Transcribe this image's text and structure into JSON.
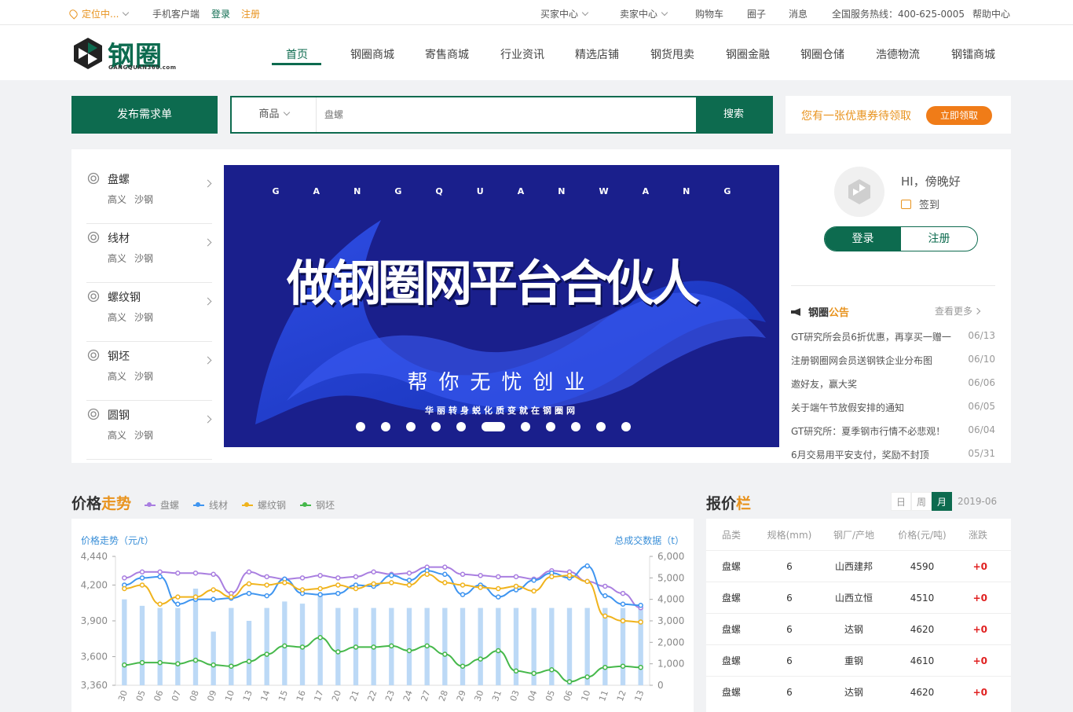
{
  "topbar": {
    "location": "定位中...",
    "mobile": "手机客户端",
    "login": "登录",
    "register": "注册",
    "buyer_center": "买家中心",
    "seller_center": "卖家中心",
    "cart": "购物车",
    "circle": "圈子",
    "messages": "消息",
    "hotline": "全国服务热线：400-625-0005",
    "help": "帮助中心"
  },
  "logo": {
    "text": "钢圈",
    "sub": "GANGQUAN360.com"
  },
  "nav": [
    "首页",
    "钢圈商城",
    "寄售商城",
    "行业资讯",
    "精选店铺",
    "钢货甩卖",
    "钢圈金融",
    "钢圈仓储",
    "浩德物流",
    "钢镭商城"
  ],
  "search": {
    "publish_label": "发布需求单",
    "category": "商品",
    "placeholder": "盘螺",
    "button": "搜索"
  },
  "coupon": {
    "text": "您有一张优惠券待领取",
    "button": "立即领取"
  },
  "categories": [
    {
      "name": "盘螺",
      "subs": [
        "高义",
        "沙钢"
      ]
    },
    {
      "name": "线材",
      "subs": [
        "高义",
        "沙钢"
      ]
    },
    {
      "name": "螺纹钢",
      "subs": [
        "高义",
        "沙钢"
      ]
    },
    {
      "name": "钢坯",
      "subs": [
        "高义",
        "沙钢"
      ]
    },
    {
      "name": "圆钢",
      "subs": [
        "高义",
        "沙钢"
      ]
    }
  ],
  "banner": {
    "letters": [
      "G",
      "A",
      "N",
      "G",
      "Q",
      "U",
      "A",
      "N",
      "W",
      "A",
      "N",
      "G"
    ],
    "title": "做钢圈网平台合伙人",
    "slogan": "帮你无忧创业",
    "subline": "华丽转身蜕化质变就在钢圈网",
    "dot_count": 11,
    "active_dot": 5
  },
  "user": {
    "greeting": "HI，傍晚好",
    "checkin": "签到",
    "login": "登录",
    "register": "注册"
  },
  "notices": {
    "title_a": "钢圈",
    "title_b": "公告",
    "more": "查看更多",
    "items": [
      {
        "text": "GT研究所会员6折优惠，再享买一赠一",
        "date": "06/13"
      },
      {
        "text": "注册钢圈网会员送钢铁企业分布图",
        "date": "06/10"
      },
      {
        "text": "邀好友，赢大奖",
        "date": "06/06"
      },
      {
        "text": "关于端午节放假安排的通知",
        "date": "06/05"
      },
      {
        "text": "GT研究所：夏季钢市行情不必悲观！",
        "date": "06/04"
      },
      {
        "text": "6月交易用平安支付，奖励不封顶",
        "date": "05/31"
      }
    ]
  },
  "price_section": {
    "title_a": "价格",
    "title_b": "走势",
    "legend": [
      {
        "name": "盘螺",
        "color": "#a97ee0"
      },
      {
        "name": "线材",
        "color": "#3f95f0"
      },
      {
        "name": "螺纹钢",
        "color": "#f0b31c"
      },
      {
        "name": "钢坯",
        "color": "#45b84a"
      }
    ]
  },
  "chart_data": {
    "type": "line",
    "left_label": "价格走势（元/t）",
    "right_label": "总成交数据（t）",
    "x": [
      "30",
      "05",
      "06",
      "07",
      "08",
      "09",
      "10",
      "13",
      "14",
      "15",
      "16",
      "17",
      "20",
      "21",
      "22",
      "23",
      "24",
      "27",
      "28",
      "29",
      "30",
      "31",
      "03",
      "04",
      "05",
      "06",
      "10",
      "11",
      "12",
      "13"
    ],
    "y_left_ticks": [
      3360,
      3600,
      3900,
      4200,
      4440
    ],
    "y_right_ticks": [
      0,
      1000,
      2000,
      3000,
      4000,
      5000,
      6000
    ],
    "ylim_left": [
      3360,
      4440
    ],
    "ylim_right": [
      0,
      6000
    ],
    "series": [
      {
        "name": "盘螺",
        "color": "#a97ee0",
        "values": [
          4260,
          4310,
          4310,
          4300,
          4300,
          4290,
          4130,
          4310,
          4270,
          4250,
          4260,
          4280,
          4260,
          4270,
          4310,
          4290,
          4300,
          4350,
          4350,
          4290,
          4280,
          4270,
          4270,
          4250,
          4320,
          4310,
          4230,
          4190,
          4130,
          4010
        ]
      },
      {
        "name": "线材",
        "color": "#3f95f0",
        "values": [
          4200,
          4260,
          4270,
          4040,
          4080,
          4080,
          4090,
          4130,
          4110,
          4250,
          4130,
          4120,
          4130,
          4200,
          4190,
          4280,
          4240,
          4320,
          4290,
          4120,
          4200,
          4100,
          4160,
          4240,
          4300,
          4260,
          4360,
          4110,
          4040,
          4030
        ]
      },
      {
        "name": "螺纹钢",
        "color": "#f0b31c",
        "values": [
          4170,
          4200,
          4040,
          4100,
          4100,
          4160,
          4100,
          4210,
          4200,
          4220,
          4160,
          4170,
          4200,
          4170,
          4210,
          4220,
          4200,
          4290,
          4220,
          4200,
          4180,
          4170,
          4190,
          4150,
          4270,
          4280,
          4230,
          3940,
          3900,
          3890
        ]
      },
      {
        "name": "钢坯",
        "color": "#45b84a",
        "values": [
          3530,
          3550,
          3550,
          3540,
          3570,
          3530,
          3520,
          3560,
          3620,
          3690,
          3680,
          3760,
          3640,
          3680,
          3680,
          3690,
          3650,
          3690,
          3620,
          3520,
          3580,
          3650,
          3480,
          3460,
          3490,
          3390,
          3430,
          3510,
          3520,
          3510
        ]
      },
      {
        "name": "总成交数据",
        "type": "bar",
        "axis": "right",
        "values": [
          4000,
          3700,
          3600,
          3600,
          4500,
          2500,
          3600,
          3000,
          3600,
          3900,
          3800,
          4200,
          3600,
          3600,
          3600,
          3600,
          3600,
          3600,
          3600,
          3600,
          3600,
          3600,
          3600,
          3600,
          3600,
          3600,
          3600,
          3600,
          3600,
          3600
        ]
      }
    ]
  },
  "quotes": {
    "title_a": "报价",
    "title_b": "栏",
    "range_tabs": [
      "日",
      "周",
      "月"
    ],
    "active_range": 2,
    "date": "2019-06",
    "headers": [
      "品类",
      "规格(mm)",
      "钢厂/产地",
      "价格(元/吨)",
      "涨跌"
    ],
    "rows": [
      [
        "盘螺",
        "6",
        "山西建邦",
        "4590",
        "+0"
      ],
      [
        "盘螺",
        "6",
        "山西立恒",
        "4510",
        "+0"
      ],
      [
        "盘螺",
        "6",
        "达钢",
        "4620",
        "+0"
      ],
      [
        "盘螺",
        "6",
        "重钢",
        "4610",
        "+0"
      ],
      [
        "盘螺",
        "6",
        "达钢",
        "4620",
        "+0"
      ]
    ]
  }
}
